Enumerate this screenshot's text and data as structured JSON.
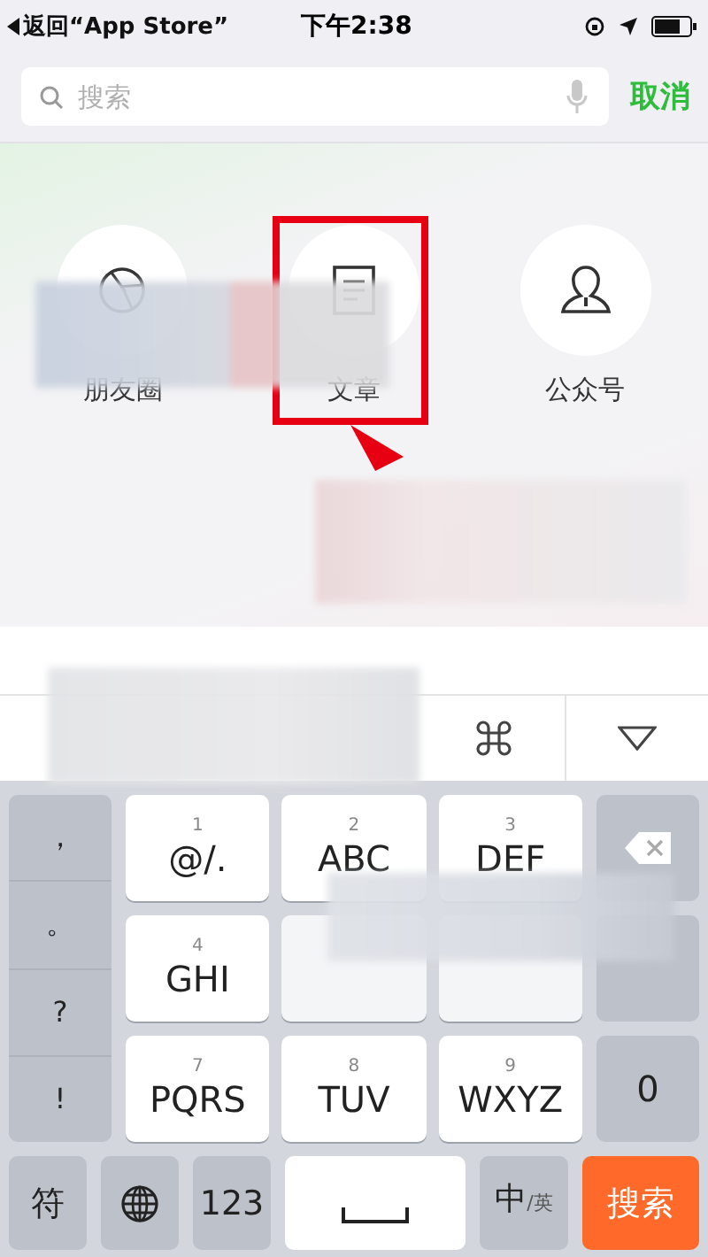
{
  "status_bar": {
    "back": "返回“App Store”",
    "time": "下午2:38"
  },
  "search": {
    "placeholder": "搜索",
    "cancel": "取消"
  },
  "categories": [
    {
      "label": "朋友圈",
      "kind": "aperture",
      "selected": false
    },
    {
      "label": "文章",
      "kind": "document",
      "selected": true
    },
    {
      "label": "公众号",
      "kind": "person",
      "selected": false
    }
  ],
  "keyboard": {
    "symbols": [
      "，",
      "。",
      "?",
      "!"
    ],
    "keys": [
      {
        "digit": "1",
        "label": "@/."
      },
      {
        "digit": "2",
        "label": "ABC"
      },
      {
        "digit": "3",
        "label": "DEF"
      },
      {
        "digit": "4",
        "label": "GHI"
      },
      {
        "kind": "covered"
      },
      {
        "kind": "covered"
      },
      {
        "digit": "7",
        "label": "PQRS"
      },
      {
        "digit": "8",
        "label": "TUV"
      },
      {
        "digit": "9",
        "label": "WXYZ"
      }
    ],
    "right": [
      {
        "kind": "delete"
      },
      {
        "kind": "hidden"
      },
      {
        "kind": "text",
        "label": "0"
      }
    ],
    "bottom": [
      {
        "kind": "text",
        "label": "符"
      },
      {
        "kind": "globe"
      },
      {
        "kind": "text",
        "label": "123"
      },
      {
        "kind": "space"
      },
      {
        "kind": "lang",
        "label": "中",
        "sub": "/英"
      },
      {
        "kind": "action",
        "label": "搜索"
      }
    ]
  }
}
